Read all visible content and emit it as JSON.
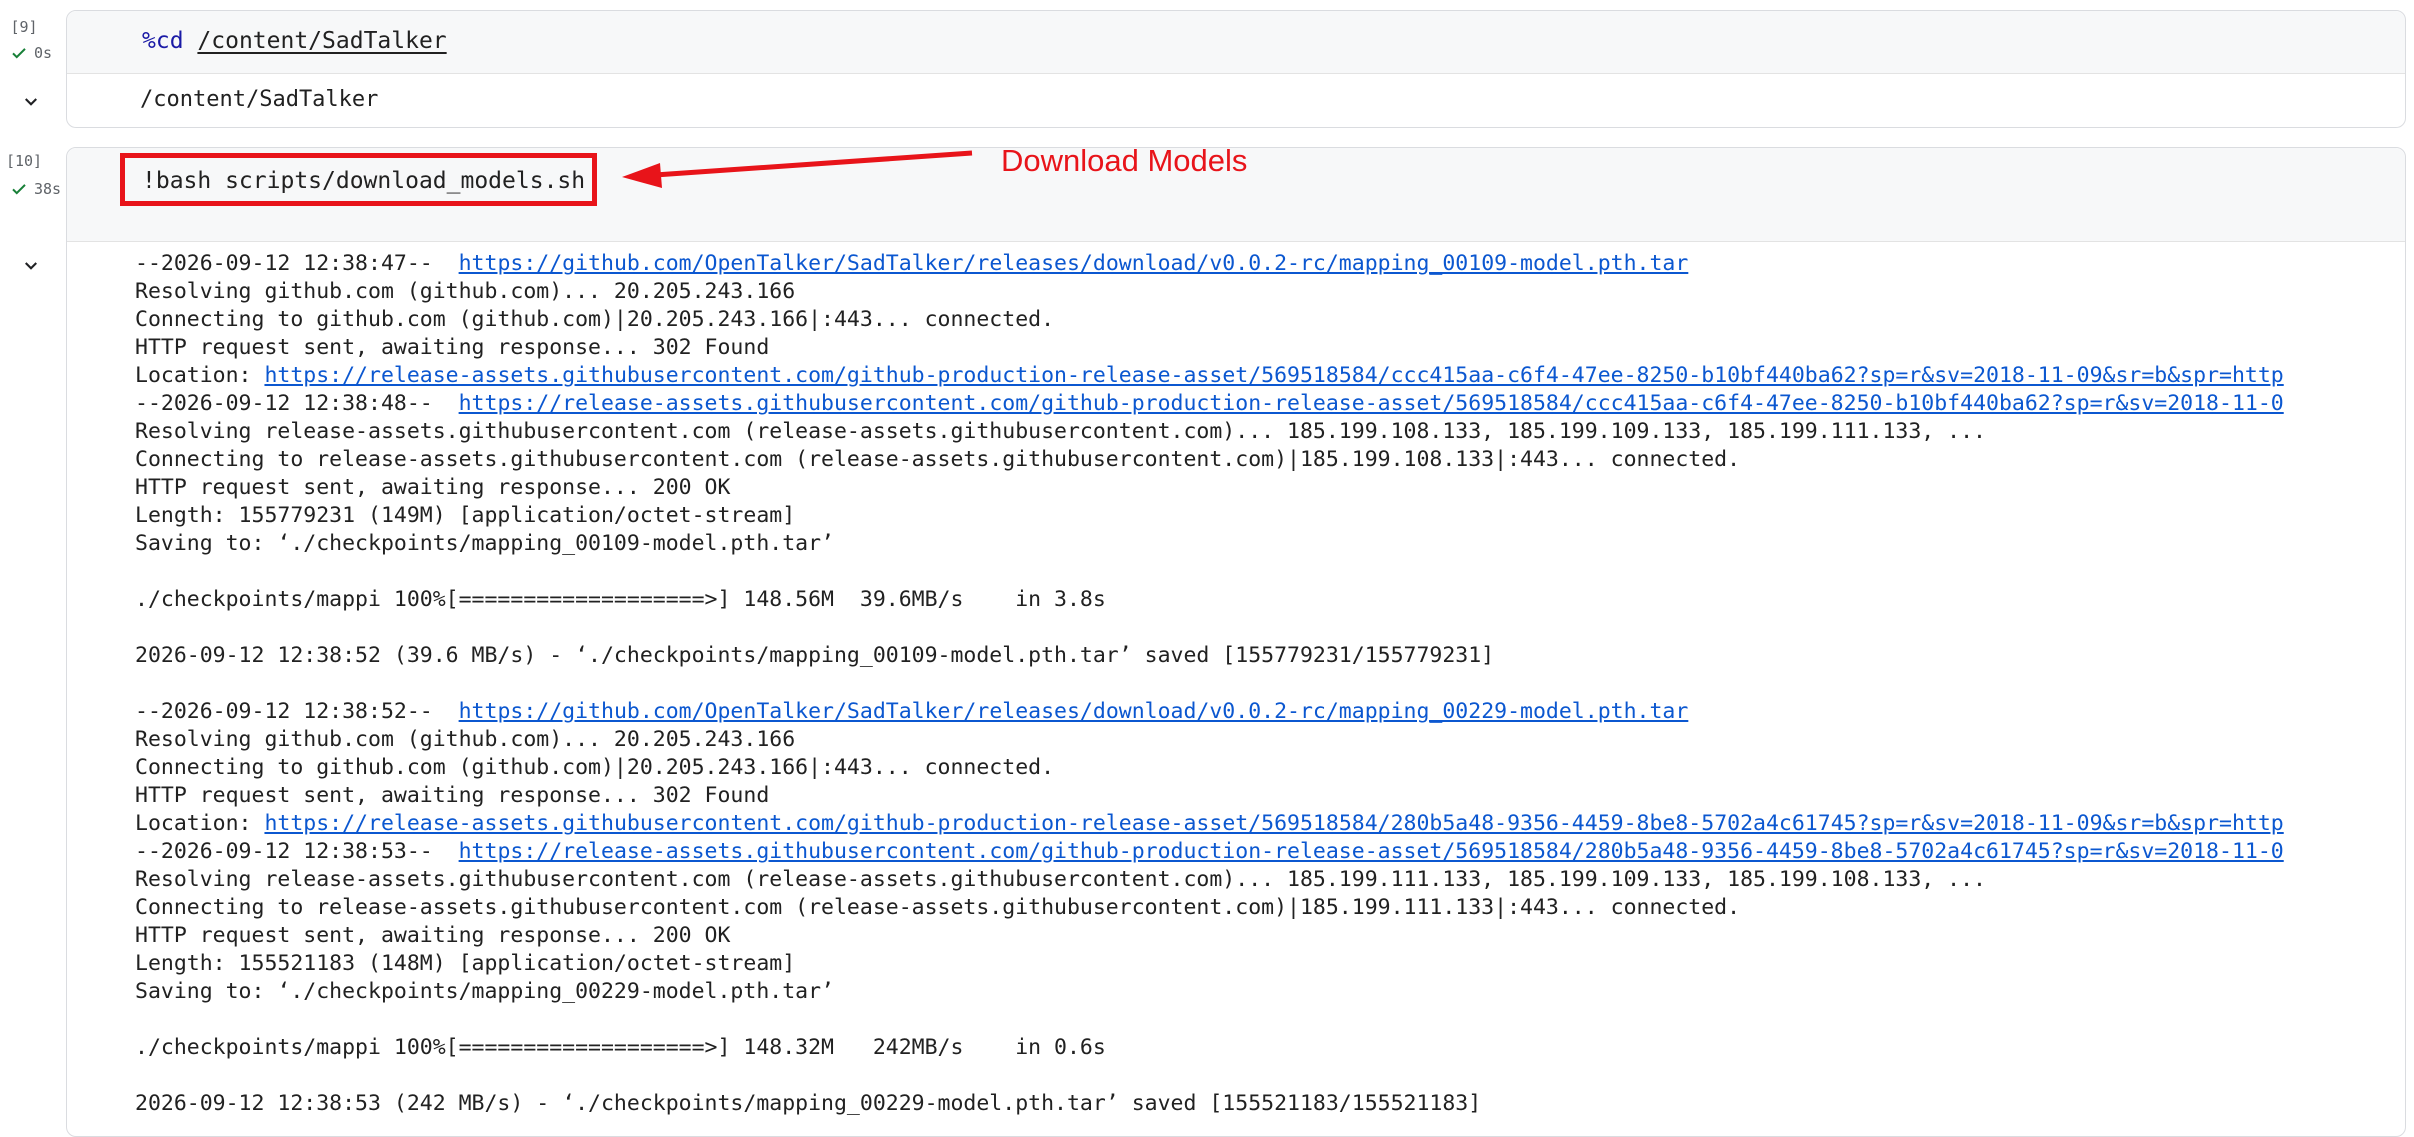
{
  "cell1": {
    "exec_count": "[9]",
    "status_time": "0s",
    "code_magic": "%cd",
    "code_arg": "/content/SadTalker",
    "output": "/content/SadTalker"
  },
  "cell2": {
    "exec_count": "[10]",
    "status_time": "38s",
    "code": "!bash scripts/download_models.sh"
  },
  "annotation": {
    "label": "Download Models",
    "color": "#e8141a"
  },
  "log": {
    "block1": {
      "start_prefix": "--2026-09-12 12:38:47--  ",
      "start_url": "https://github.com/OpenTalker/SadTalker/releases/download/v0.0.2-rc/mapping_00109-model.pth.tar",
      "resolving1": "Resolving github.com (github.com)... 20.205.243.166",
      "connecting1": "Connecting to github.com (github.com)|20.205.243.166|:443... connected.",
      "http1": "HTTP request sent, awaiting response... 302 Found",
      "location_prefix": "Location: ",
      "location_url": "https://release-assets.githubusercontent.com/github-production-release-asset/569518584/ccc415aa-c6f4-47ee-8250-b10bf440ba62?sp=r&sv=2018-11-09&sr=b&spr=http",
      "redirect_prefix": "--2026-09-12 12:38:48--  ",
      "redirect_url": "https://release-assets.githubusercontent.com/github-production-release-asset/569518584/ccc415aa-c6f4-47ee-8250-b10bf440ba62?sp=r&sv=2018-11-0",
      "resolving2": "Resolving release-assets.githubusercontent.com (release-assets.githubusercontent.com)... 185.199.108.133, 185.199.109.133, 185.199.111.133, ...",
      "connecting2": "Connecting to release-assets.githubusercontent.com (release-assets.githubusercontent.com)|185.199.108.133|:443... connected.",
      "http2": "HTTP request sent, awaiting response... 200 OK",
      "length": "Length: 155779231 (149M) [application/octet-stream]",
      "saving": "Saving to: ‘./checkpoints/mapping_00109-model.pth.tar’",
      "progress": "./checkpoints/mappi 100%[===================>] 148.56M  39.6MB/s    in 3.8s",
      "saved": "2026-09-12 12:38:52 (39.6 MB/s) - ‘./checkpoints/mapping_00109-model.pth.tar’ saved [155779231/155779231]"
    },
    "block2": {
      "start_prefix": "--2026-09-12 12:38:52--  ",
      "start_url": "https://github.com/OpenTalker/SadTalker/releases/download/v0.0.2-rc/mapping_00229-model.pth.tar",
      "resolving1": "Resolving github.com (github.com)... 20.205.243.166",
      "connecting1": "Connecting to github.com (github.com)|20.205.243.166|:443... connected.",
      "http1": "HTTP request sent, awaiting response... 302 Found",
      "location_prefix": "Location: ",
      "location_url": "https://release-assets.githubusercontent.com/github-production-release-asset/569518584/280b5a48-9356-4459-8be8-5702a4c61745?sp=r&sv=2018-11-09&sr=b&spr=http",
      "redirect_prefix": "--2026-09-12 12:38:53--  ",
      "redirect_url": "https://release-assets.githubusercontent.com/github-production-release-asset/569518584/280b5a48-9356-4459-8be8-5702a4c61745?sp=r&sv=2018-11-0",
      "resolving2": "Resolving release-assets.githubusercontent.com (release-assets.githubusercontent.com)... 185.199.111.133, 185.199.109.133, 185.199.108.133, ...",
      "connecting2": "Connecting to release-assets.githubusercontent.com (release-assets.githubusercontent.com)|185.199.111.133|:443... connected.",
      "http2": "HTTP request sent, awaiting response... 200 OK",
      "length": "Length: 155521183 (148M) [application/octet-stream]",
      "saving": "Saving to: ‘./checkpoints/mapping_00229-model.pth.tar’",
      "progress": "./checkpoints/mappi 100%[===================>] 148.32M   242MB/s    in 0.6s",
      "saved": "2026-09-12 12:38:53 (242 MB/s) - ‘./checkpoints/mapping_00229-model.pth.tar’ saved [155521183/155521183]"
    }
  }
}
